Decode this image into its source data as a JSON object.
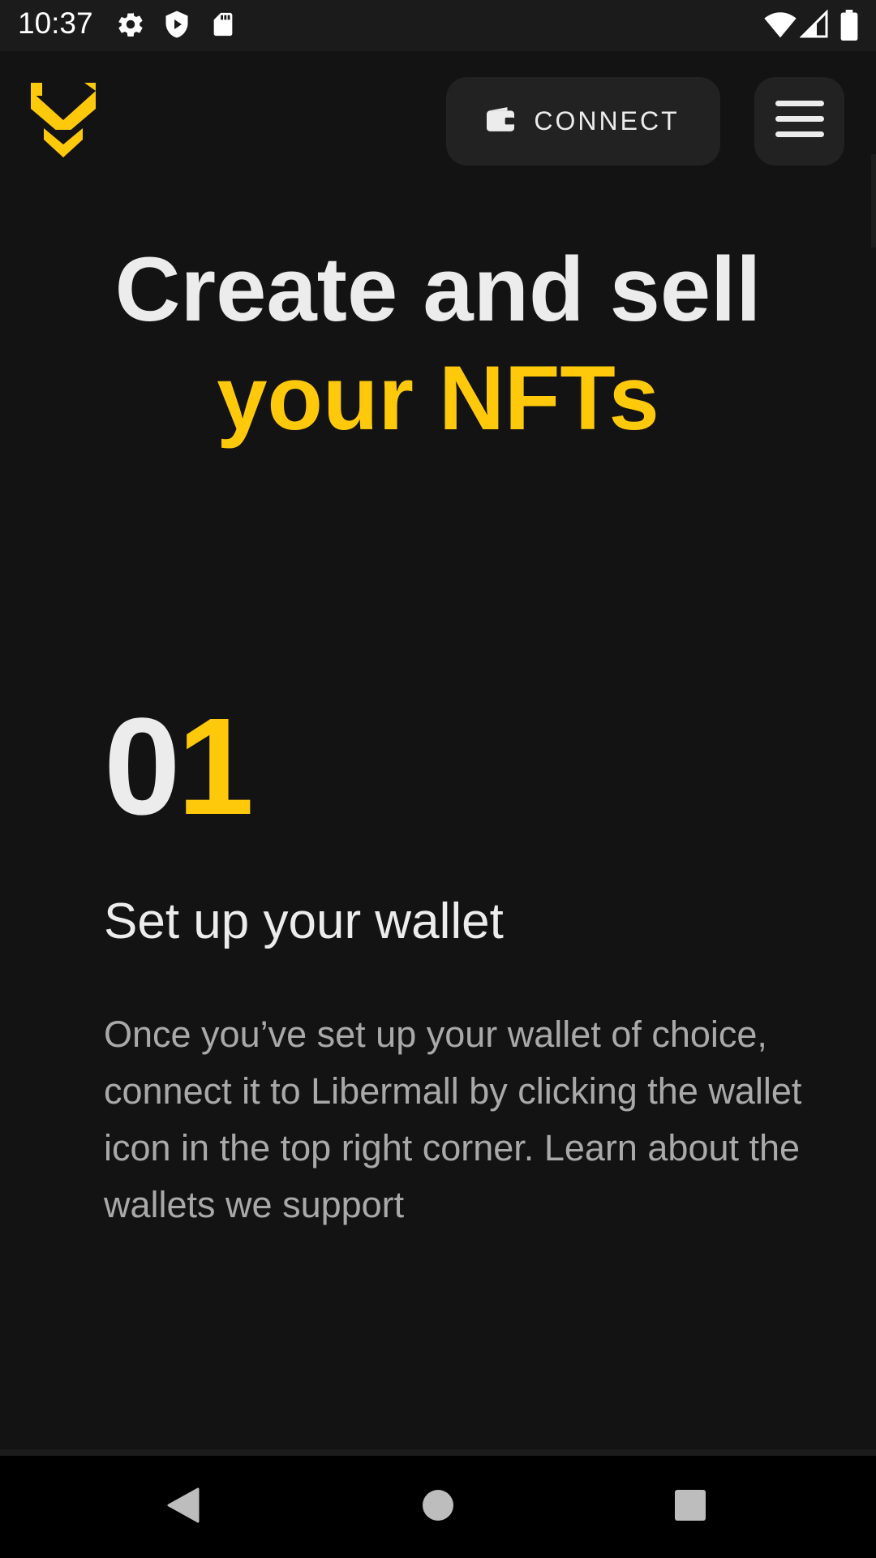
{
  "status_bar": {
    "time": "10:37",
    "left_icons": [
      "gear-icon",
      "shield-play-icon",
      "sd-card-icon"
    ],
    "right_icons": [
      "wifi-icon",
      "signal-icon",
      "battery-icon"
    ]
  },
  "header": {
    "logo_icon": "libermall-logo-icon",
    "connect_label": "CONNECT",
    "connect_icon": "wallet-icon",
    "menu_icon": "hamburger-menu-icon"
  },
  "hero": {
    "line1": "Create and sell",
    "line2": "your NFTs"
  },
  "step": {
    "number_first": "0",
    "number_second": "1",
    "title": "Set up your wallet",
    "description": "Once you’ve set up your wallet of choice, connect it to Libermall by clicking the wallet icon in the top right corner. Learn about the wallets we support"
  },
  "nav_bar": {
    "back_icon": "back-triangle-icon",
    "home_icon": "home-circle-icon",
    "recents_icon": "recents-square-icon"
  },
  "colors": {
    "background": "#131313",
    "accent": "#fec90a",
    "button_bg": "#222222",
    "text_primary": "#ececec",
    "text_secondary": "#a9a9a9"
  }
}
